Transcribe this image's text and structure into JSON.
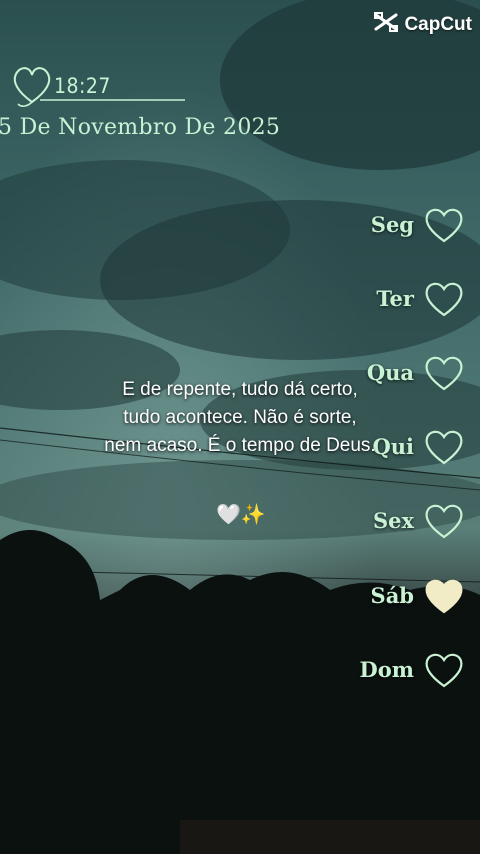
{
  "watermark": {
    "label": "CapCut",
    "icon": "capcut-logo-icon"
  },
  "clock": {
    "time": "18:27",
    "icon": "heart-outline-icon"
  },
  "date": "5 De Novembro De 2025",
  "quote": {
    "lines": [
      "E de repente, tudo dá certo,",
      "tudo acontece. Não é sorte,",
      "nem acaso. É o tempo de Deus."
    ],
    "emoji": "🤍✨"
  },
  "weekdays": [
    {
      "label": "Seg",
      "filled": false
    },
    {
      "label": "Ter",
      "filled": false
    },
    {
      "label": "Qua",
      "filled": false
    },
    {
      "label": "Qui",
      "filled": false
    },
    {
      "label": "Sex",
      "filled": false
    },
    {
      "label": "Sáb",
      "filled": true
    },
    {
      "label": "Dom",
      "filled": false
    }
  ],
  "colors": {
    "accent": "#c9f1d4",
    "heart_fill": "#f2ecc6",
    "sky_top": "#2f5a59",
    "sky_mid": "#5d8783",
    "sunset": "#d2593a"
  }
}
